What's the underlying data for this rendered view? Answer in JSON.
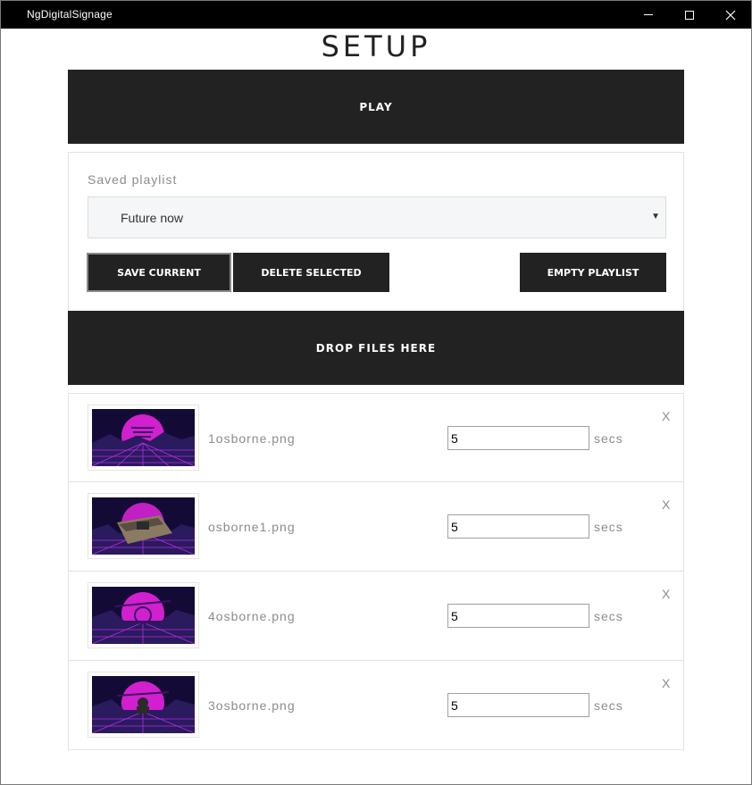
{
  "window": {
    "title": "NgDigitalSignage",
    "minimize_glyph": "",
    "maximize_glyph": "",
    "close_glyph": "✕"
  },
  "page": {
    "heading": "SETUP",
    "play_label": "PLAY",
    "drop_label": "DROP FILES HERE"
  },
  "playlist": {
    "saved_label": "Saved playlist",
    "selected": "Future now",
    "caret": "▼",
    "save_button": "SAVE CURRENT",
    "delete_button": "DELETE SELECTED",
    "empty_button": "EMPTY PLAYLIST"
  },
  "files": [
    {
      "name": "1osborne.png",
      "seconds": "5",
      "unit": "secs",
      "remove": "X"
    },
    {
      "name": "osborne1.png",
      "seconds": "5",
      "unit": "secs",
      "remove": "X"
    },
    {
      "name": "4osborne.png",
      "seconds": "5",
      "unit": "secs",
      "remove": "X"
    },
    {
      "name": "3osborne.png",
      "seconds": "5",
      "unit": "secs",
      "remove": "X"
    }
  ],
  "colors": {
    "dark": "#222222",
    "thumb_bg": "#1a0a3a",
    "thumb_sun": "#d21fd0",
    "thumb_grid": "#b82ce6"
  }
}
